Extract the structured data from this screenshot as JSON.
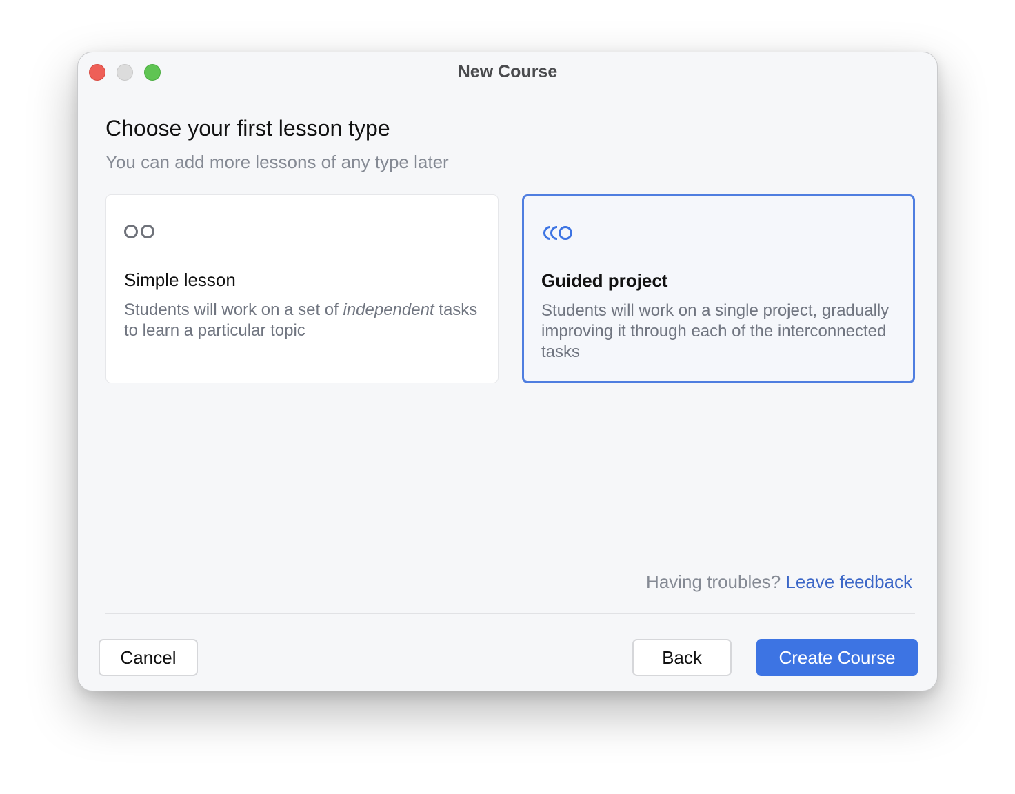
{
  "window": {
    "title": "New Course"
  },
  "page": {
    "heading": "Choose your first lesson type",
    "subheading": "You can add more lessons of any type later"
  },
  "lesson_types": [
    {
      "title": "Simple lesson",
      "description_prefix": "Students will work on a set of ",
      "description_emphasis": "independent",
      "description_suffix": " tasks to learn a particular topic",
      "icon": "two-circles-icon",
      "selected": false
    },
    {
      "title": "Guided project",
      "description": "Students will work on a single project, gradually improving it through each of the interconnected tasks",
      "icon": "chained-circles-icon",
      "selected": true
    }
  ],
  "feedback": {
    "prompt": "Having troubles?",
    "link": "Leave feedback"
  },
  "buttons": {
    "cancel": "Cancel",
    "back": "Back",
    "create": "Create Course"
  },
  "colors": {
    "accent": "#3d74e3",
    "selected_border": "#4f7ee0",
    "link": "#3c67c7",
    "close": "#ee5f57",
    "minimize": "#dcdcdc",
    "maximize": "#5fc453"
  }
}
